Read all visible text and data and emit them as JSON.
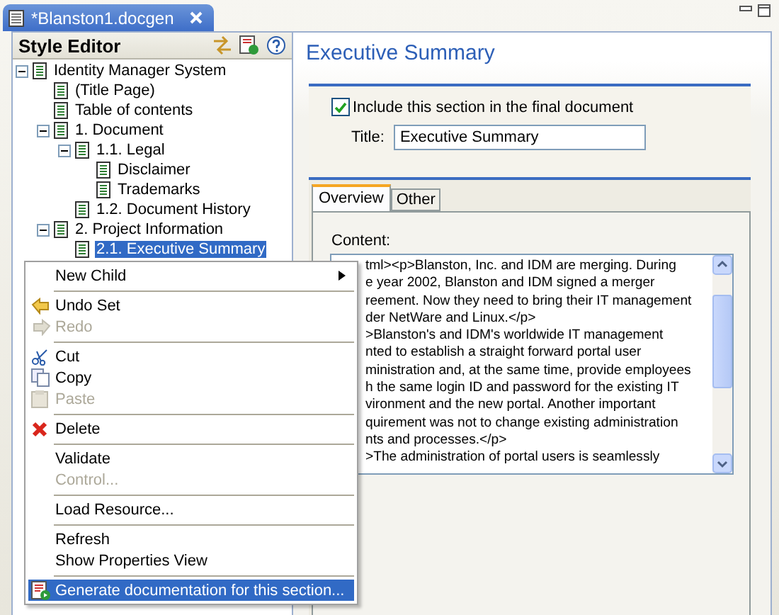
{
  "editor_tab": {
    "title": "*Blanston1.docgen"
  },
  "style_editor": {
    "title": "Style Editor",
    "tree": [
      {
        "label": "Identity Manager System",
        "expanded": true,
        "selected": false,
        "children": [
          {
            "label": "(Title Page)",
            "selected": false
          },
          {
            "label": "Table of contents",
            "selected": false
          },
          {
            "label": "1. Document",
            "expanded": true,
            "selected": false,
            "children": [
              {
                "label": "1.1. Legal",
                "expanded": true,
                "selected": false,
                "children": [
                  {
                    "label": "Disclaimer",
                    "selected": false
                  },
                  {
                    "label": "Trademarks",
                    "selected": false
                  }
                ]
              },
              {
                "label": "1.2. Document History",
                "selected": false
              }
            ]
          },
          {
            "label": "2. Project  Information",
            "expanded": true,
            "selected": false,
            "children": [
              {
                "label": "2.1. Executive Summary",
                "selected": true
              }
            ]
          }
        ]
      }
    ]
  },
  "detail": {
    "title": "Executive Summary",
    "include_checkbox": {
      "label": "Include this section in the final document",
      "checked": true
    },
    "title_field": {
      "label": "Title:",
      "value": "Executive Summary"
    },
    "tabs": [
      {
        "label": "Overview",
        "selected": true
      },
      {
        "label": "Other",
        "selected": false
      }
    ],
    "content": {
      "label": "Content:",
      "lines": [
        "tml><p>Blanston, Inc. and IDM are merging. During",
        "e year 2002, Blanston and IDM signed a merger",
        "reement. Now they need to bring their IT management",
        "der NetWare and Linux.</p>",
        ">Blanston's and IDM's worldwide IT management",
        "nted to establish a straight forward portal user",
        "ministration and, at the same time, provide employees",
        "h the same login ID and password for the existing IT",
        "vironment and the new portal. Another important",
        "quirement was not to change existing administration",
        "nts and processes.</p>",
        ">The administration of portal users is seamlessly"
      ]
    }
  },
  "context_menu": {
    "items": [
      {
        "kind": "item",
        "label": "New Child",
        "submenu": true,
        "disabled": false,
        "selected": false
      },
      {
        "kind": "separator"
      },
      {
        "kind": "item",
        "label": "Undo Set",
        "disabled": false,
        "selected": false
      },
      {
        "kind": "item",
        "label": "Redo",
        "disabled": true,
        "selected": false
      },
      {
        "kind": "separator"
      },
      {
        "kind": "item",
        "label": "Cut",
        "disabled": false,
        "selected": false
      },
      {
        "kind": "item",
        "label": "Copy",
        "disabled": false,
        "selected": false
      },
      {
        "kind": "item",
        "label": "Paste",
        "disabled": true,
        "selected": false
      },
      {
        "kind": "separator"
      },
      {
        "kind": "item",
        "label": "Delete",
        "disabled": false,
        "selected": false
      },
      {
        "kind": "separator"
      },
      {
        "kind": "item",
        "label": "Validate",
        "disabled": false,
        "selected": false
      },
      {
        "kind": "item",
        "label": "Control...",
        "disabled": true,
        "selected": false
      },
      {
        "kind": "separator"
      },
      {
        "kind": "item",
        "label": "Load Resource...",
        "disabled": false,
        "selected": false
      },
      {
        "kind": "separator"
      },
      {
        "kind": "item",
        "label": "Refresh",
        "disabled": false,
        "selected": false
      },
      {
        "kind": "item",
        "label": "Show Properties View",
        "disabled": false,
        "selected": false
      },
      {
        "kind": "separator"
      },
      {
        "kind": "item",
        "label": "Generate documentation for this section...",
        "disabled": false,
        "selected": true
      }
    ]
  }
}
